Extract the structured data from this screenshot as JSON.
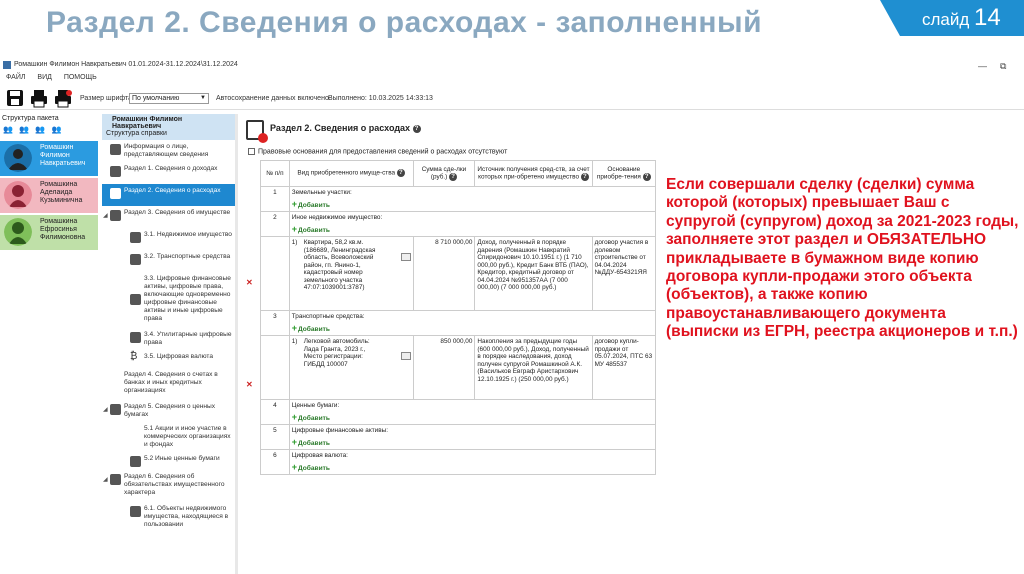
{
  "slide": {
    "title": "Раздел 2. Сведения о расходах - заполненный",
    "number_label": "слайд",
    "number": "14",
    "accent_color": "#1f8fd1"
  },
  "app": {
    "window_title": "Ромашкин Филимон Навкратьевич 01.01.2024-31.12.2024\\31.12.2024",
    "menu": [
      "ФАЙЛ",
      "ВИД",
      "ПОМОЩЬ"
    ],
    "toolbar": {
      "font_size_label": "Размер шрифта:",
      "font_size_value": "По умолчанию",
      "autosave_text": "Автосохранение данных включено.",
      "done_text": "Выполнено: 10.03.2025 14:33:13"
    }
  },
  "left_panel": {
    "title": "Структура пакета",
    "persons": [
      {
        "name": "Ромашкин Филимон Навкратьевич"
      },
      {
        "name": "Ромашкина Аделаида Кузьминична"
      },
      {
        "name": "Ромашкина Ефросинья Филимоновна"
      }
    ]
  },
  "nav_panel": {
    "person": "Ромашкин Филимон Навкратьевич",
    "subtitle": "Структура справки",
    "items": [
      {
        "label": "Информация о лице, представляющем сведения"
      },
      {
        "label": "Раздел 1. Сведения о доходах"
      },
      {
        "label": "Раздел 2. Сведения о расходах"
      },
      {
        "label": "Раздел 3. Сведения об имуществе"
      },
      {
        "label": "3.1. Недвижимое имущество"
      },
      {
        "label": "3.2. Транспортные средства"
      },
      {
        "label": "3.3. Цифровые финансовые активы, цифровые права, включающие одновременно цифровые финансовые активы и иные цифровые права"
      },
      {
        "label": "3.4. Утилитарные цифровые права"
      },
      {
        "label": "3.5. Цифровая валюта"
      },
      {
        "label": "Раздел 4. Сведения о счетах в банках и иных кредитных организациях"
      },
      {
        "label": "Раздел 5. Сведения о ценных бумагах"
      },
      {
        "label": "5.1 Акции и иное участие в коммерческих организациях и фондах"
      },
      {
        "label": "5.2 Иные ценные бумаги"
      },
      {
        "label": "Раздел 6. Сведения об обязательствах имущественного характера"
      },
      {
        "label": "6.1. Объекты недвижимого имущества, находящиеся в пользовании"
      }
    ]
  },
  "section": {
    "title": "Раздел 2. Сведения о расходах",
    "checkbox_label": "Правовые основания для предоставления сведений о расходах отсутствуют",
    "columns": [
      "№ п/п",
      "Вид приобретенного имуще-ства",
      "Сумма сде-лки (руб.)",
      "Источник получения сред-ств, за счет которых при-обретено имущество",
      "Основание приобре-тения"
    ],
    "add_label": "Добавить",
    "groups": [
      {
        "num": "1",
        "name": "Земельные участки:",
        "items": []
      },
      {
        "num": "2",
        "name": "Иное недвижимое имущество:",
        "items": [
          {
            "num": "1)",
            "asset": "Квартира, 58,2 кв.м. (186689, Ленинградская область, Всеволожский район, гп. Янино-1, кадастровый номер земельного участка 47:07:1039001:3787)",
            "amount": "8 710 000,00",
            "source": "Доход, полученный в порядке дарения (Ромашкин Навкратий Спиридонович 10.10.1951 г.) (1 710 000,00 руб.), Кредит Банк ВТБ (ПАО), Кредитор, кредитный договор от 04.04.2024 №951357АА (7 000 000,00) (7 000 000,00 руб.)",
            "basis": "договор участия в долевом строительстве от 04.04.2024 №ДДУ-654321ЯЯ"
          }
        ]
      },
      {
        "num": "3",
        "name": "Транспортные средства:",
        "items": [
          {
            "num": "1)",
            "asset": "Легковой автомобиль: Лада Гранта, 2023 г., Место регистрации: ГИБДД 100007",
            "amount": "850 000,00",
            "source": "Накопления за предыдущие годы (600 000,00 руб.), Доход, полученный в порядке наследования, доход получен супругой Ромашкиной А.К. (Васильков Евграф Аристархович 12.10.1925 г.) (250 000,00 руб.)",
            "basis": "договор купли-продажи от 05.07.2024, ПТС 63 МУ 485537"
          }
        ]
      },
      {
        "num": "4",
        "name": "Ценные бумаги:",
        "items": []
      },
      {
        "num": "5",
        "name": "Цифровые финансовые активы:",
        "items": []
      },
      {
        "num": "6",
        "name": "Цифровая валюта:",
        "items": []
      }
    ]
  },
  "annotation": {
    "text_before": "Если совершали сделку (сделки) сумма которой (которых) превышает Ваш с супругой (супругом) доход за 2021-2023 годы, заполняете этот раздел и ",
    "emphasis": "ОБЯЗАТЕЛЬНО",
    "text_after": " прикладываете в бумажном виде копию договора купли-продажи этого объекта (объектов), а также копию правоустанавливающего документа (выписки из ЕГРН, реестра акционеров и т.п.)",
    "color": "#e0121e"
  }
}
